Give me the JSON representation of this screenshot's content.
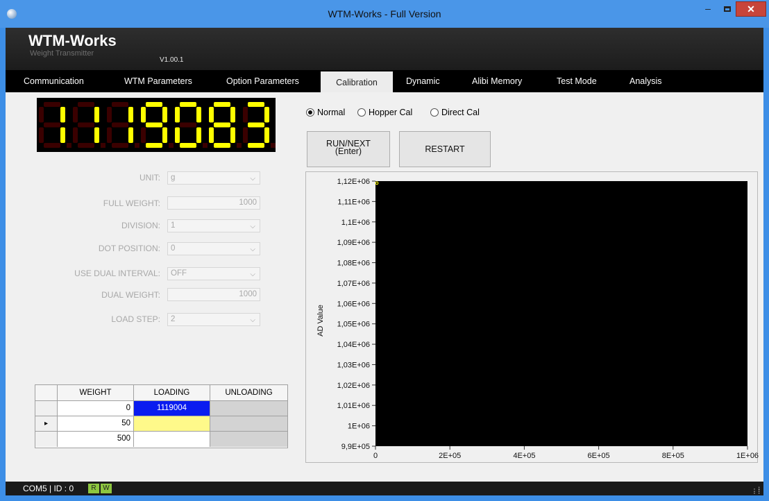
{
  "window": {
    "title": "WTM-Works - Full Version",
    "minimize_label": "–",
    "close_label": "✕"
  },
  "header": {
    "app_name": "WTM-Works",
    "subtitle": "Weight Transmitter",
    "version": "V1.00.1"
  },
  "tabs": [
    {
      "label": "Communication"
    },
    {
      "label": "WTM Parameters"
    },
    {
      "label": "Option Parameters"
    },
    {
      "label": "Calibration",
      "active": true
    },
    {
      "label": "Dynamic"
    },
    {
      "label": "Alibi Memory"
    },
    {
      "label": "Test Mode"
    },
    {
      "label": "Analysis"
    }
  ],
  "display": {
    "value": "1119083",
    "digit_color": "#ffff00",
    "dim_color": "#3a0000"
  },
  "cal_mode": {
    "options": [
      {
        "label": "Normal",
        "selected": true
      },
      {
        "label": "Hopper Cal",
        "selected": false
      },
      {
        "label": "Direct Cal",
        "selected": false
      }
    ]
  },
  "buttons": {
    "run_line1": "RUN/NEXT",
    "run_line2": "(Enter)",
    "restart": "RESTART"
  },
  "form": {
    "unit": {
      "label": "UNIT:",
      "value": "g"
    },
    "full_weight": {
      "label": "FULL WEIGHT:",
      "value": "1000"
    },
    "division": {
      "label": "DIVISION:",
      "value": "1"
    },
    "dot_position": {
      "label": "DOT POSITION:",
      "value": "0"
    },
    "use_dual_interval": {
      "label": "USE DUAL INTERVAL:",
      "value": "OFF"
    },
    "dual_weight": {
      "label": "DUAL WEIGHT:",
      "value": "1000"
    },
    "load_step": {
      "label": "LOAD STEP:",
      "value": "2"
    }
  },
  "grid": {
    "headers": [
      "WEIGHT",
      "LOADING",
      "UNLOADING"
    ],
    "rows": [
      {
        "weight": "0",
        "loading": "1119004",
        "unloading": "",
        "current": false
      },
      {
        "weight": "50",
        "loading": "",
        "unloading": "",
        "current": true
      },
      {
        "weight": "500",
        "loading": "",
        "unloading": "",
        "current": false
      }
    ],
    "row_marker": "▸"
  },
  "chart_data": {
    "type": "scatter",
    "title": "",
    "xlabel": "",
    "ylabel": "AD Value",
    "xlim": [
      0,
      1000000
    ],
    "ylim": [
      990000,
      1120000
    ],
    "x_ticks": [
      "0",
      "2E+05",
      "4E+05",
      "6E+05",
      "8E+05",
      "1E+06"
    ],
    "y_ticks": [
      "9,9E+05",
      "1E+06",
      "1,01E+06",
      "1,02E+06",
      "1,03E+06",
      "1,04E+06",
      "1,05E+06",
      "1,06E+06",
      "1,07E+06",
      "1,08E+06",
      "1,09E+06",
      "1,1E+06",
      "1,11E+06",
      "1,12E+06"
    ],
    "plot_background": "#000000",
    "series": [
      {
        "x": [
          0
        ],
        "y": [
          1119004
        ],
        "color": "#e8e800"
      }
    ]
  },
  "status": {
    "connection": "COM5 | ID : 0",
    "read_led": "R",
    "write_led": "W",
    "led_color": "#8dc63f"
  }
}
